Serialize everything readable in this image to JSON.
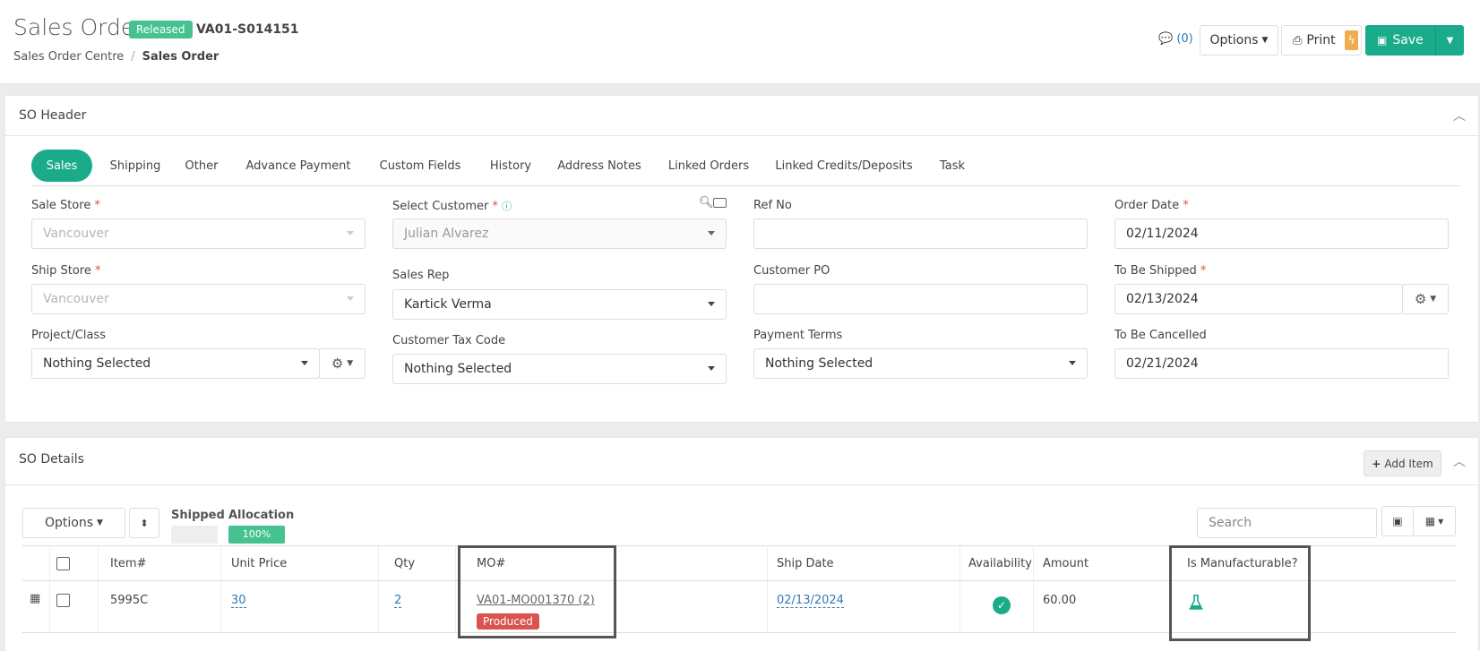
{
  "header": {
    "title": "Sales Order",
    "status_badge": "Released",
    "so_number": "VA01-S014151",
    "breadcrumb": {
      "parent": "Sales Order Centre",
      "separator": "/",
      "current": "Sales Order"
    },
    "comments_count": "(0)",
    "options_label": "Options",
    "print_label": "Print",
    "save_label": "Save"
  },
  "so_header": {
    "title": "SO Header",
    "tabs": [
      {
        "label": "Sales",
        "active": true
      },
      {
        "label": "Shipping"
      },
      {
        "label": "Other"
      },
      {
        "label": "Advance Payment"
      },
      {
        "label": "Custom Fields"
      },
      {
        "label": "History"
      },
      {
        "label": "Address Notes"
      },
      {
        "label": "Linked Orders"
      },
      {
        "label": "Linked Credits/Deposits"
      },
      {
        "label": "Task"
      }
    ],
    "fields": {
      "sale_store": {
        "label": "Sale Store",
        "value": "Vancouver"
      },
      "ship_store": {
        "label": "Ship Store",
        "value": "Vancouver"
      },
      "project_class": {
        "label": "Project/Class",
        "value": "Nothing Selected"
      },
      "select_customer": {
        "label": "Select Customer",
        "value": "Julian Alvarez"
      },
      "sales_rep": {
        "label": "Sales Rep",
        "value": "Kartick Verma"
      },
      "customer_tax_code": {
        "label": "Customer Tax Code",
        "value": "Nothing Selected"
      },
      "ref_no": {
        "label": "Ref No",
        "value": ""
      },
      "customer_po": {
        "label": "Customer PO",
        "value": ""
      },
      "payment_terms": {
        "label": "Payment Terms",
        "value": "Nothing Selected"
      },
      "order_date": {
        "label": "Order Date",
        "value": "02/11/2024"
      },
      "to_be_shipped": {
        "label": "To Be Shipped",
        "value": "02/13/2024"
      },
      "to_be_cancelled": {
        "label": "To Be Cancelled",
        "value": "02/21/2024"
      }
    },
    "required_mark": "*"
  },
  "so_details": {
    "title": "SO Details",
    "add_item_label": "Add Item",
    "options_label": "Options",
    "shipped_label": "Shipped",
    "allocation_label": "Allocation",
    "allocation_value": "100%",
    "search_placeholder": "Search",
    "columns": [
      "Item#",
      "Unit Price",
      "Qty",
      "MO#",
      "Ship Date",
      "Availability",
      "Amount",
      "Is Manufacturable?"
    ],
    "rows": [
      {
        "item": "5995C",
        "unit_price": "30",
        "qty": "2",
        "mo_number": "VA01-MO001370 (2)",
        "mo_status": "Produced",
        "ship_date": "02/13/2024",
        "amount": "60.00"
      }
    ]
  },
  "colors": {
    "accent": "#1aab8a",
    "released": "#45c290",
    "produced": "#d9534f",
    "print_bolt": "#f0ad4e"
  }
}
